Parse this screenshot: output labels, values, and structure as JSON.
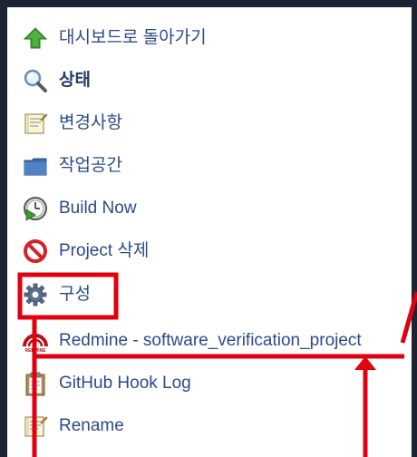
{
  "sidebar": {
    "items": [
      {
        "label": "대시보드로 돌아가기",
        "icon": "up-arrow-icon"
      },
      {
        "label": "상태",
        "icon": "magnifier-icon"
      },
      {
        "label": "변경사항",
        "icon": "notepad-icon"
      },
      {
        "label": "작업공간",
        "icon": "folder-icon"
      },
      {
        "label": "Build Now",
        "icon": "clock-play-icon"
      },
      {
        "label": "Project 삭제",
        "icon": "no-entry-icon"
      },
      {
        "label": "구성",
        "icon": "gear-icon"
      },
      {
        "label": "Redmine - software_verification_project",
        "icon": "redmine-icon"
      },
      {
        "label": "GitHub Hook Log",
        "icon": "clipboard-icon"
      },
      {
        "label": "Rename",
        "icon": "rename-notepad-icon"
      }
    ]
  },
  "annotation": {
    "color": "#e0000f"
  }
}
